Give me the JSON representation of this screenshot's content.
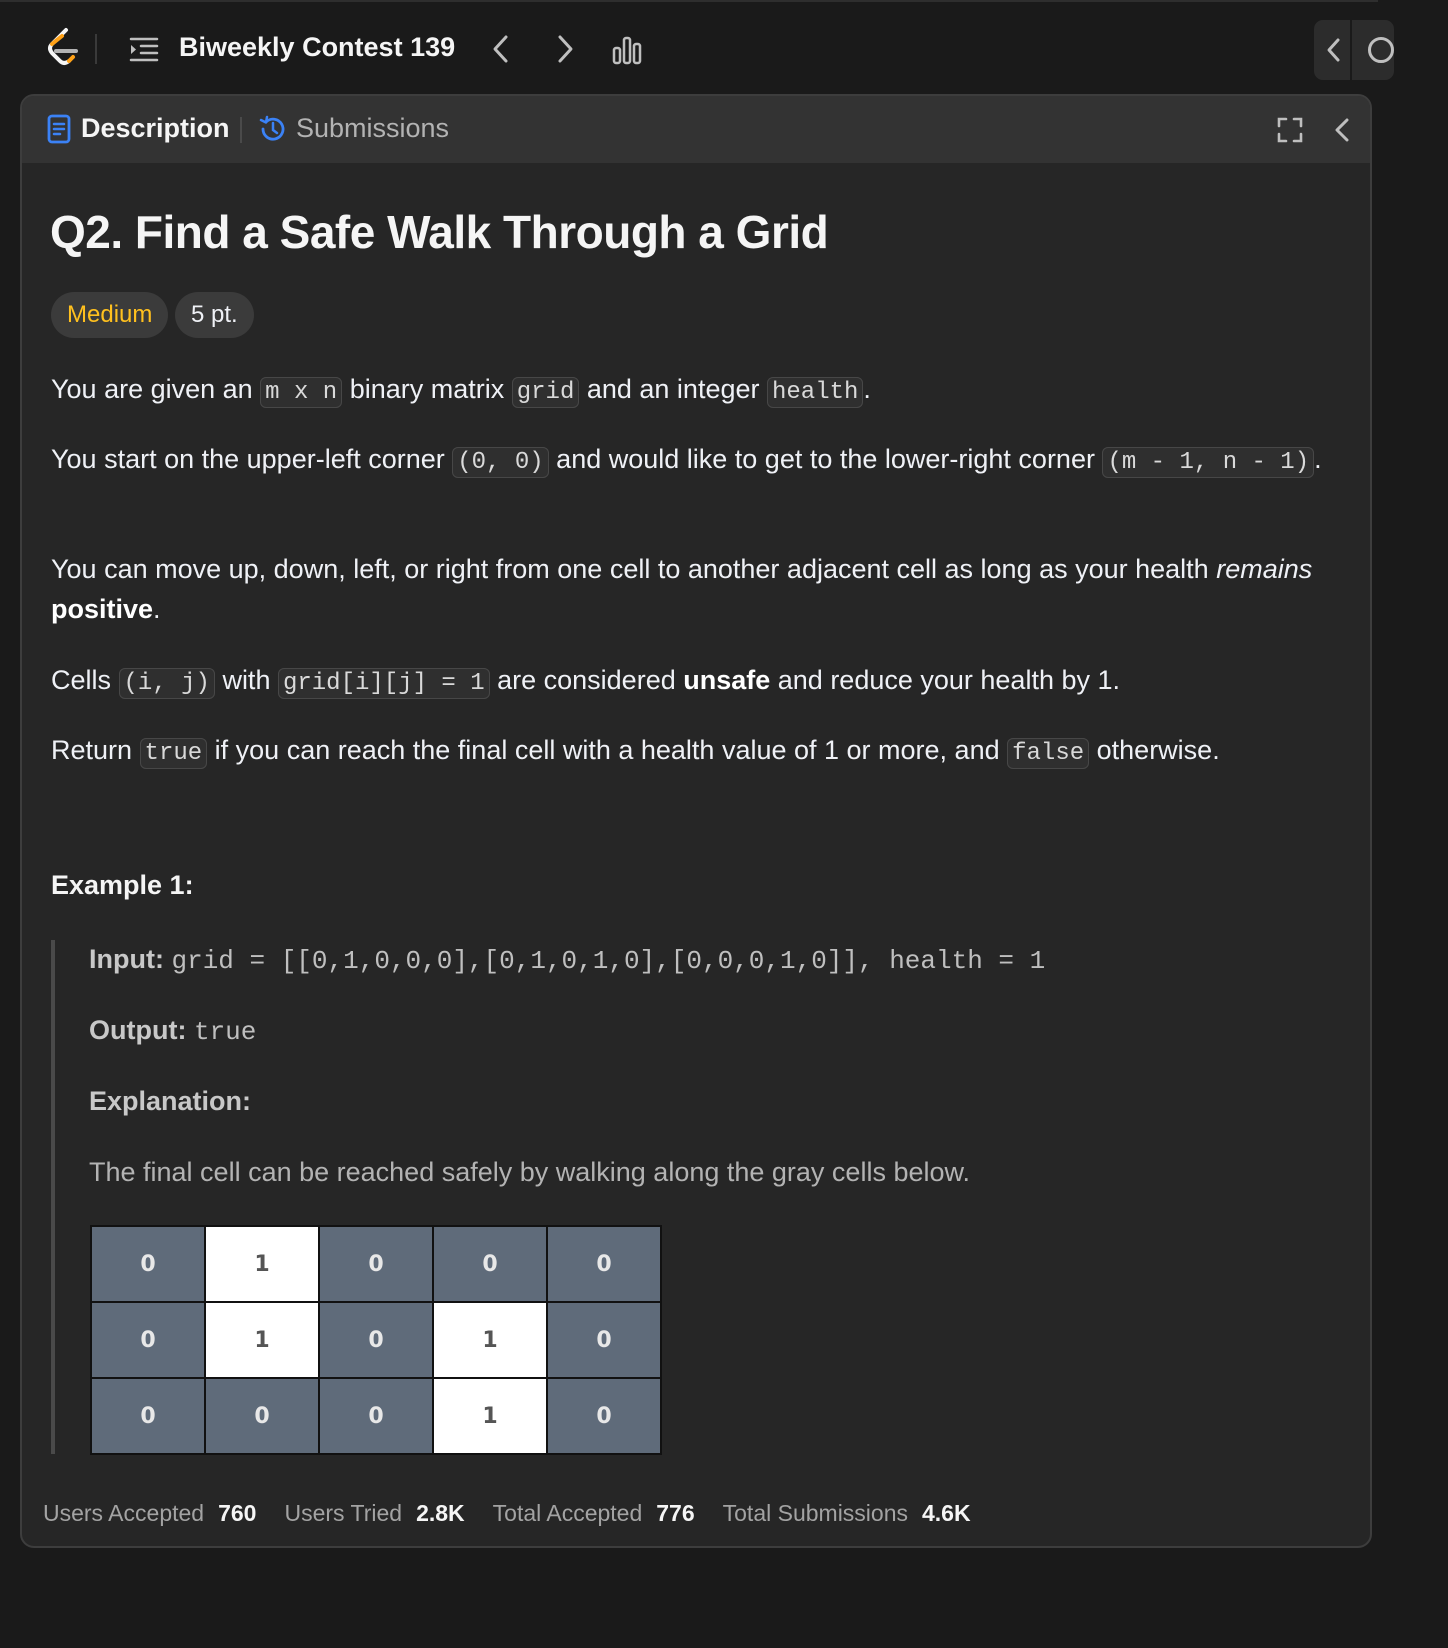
{
  "topbar": {
    "contest_title": "Biweekly Contest 139",
    "icons": [
      "leetcode-logo",
      "list-icon",
      "chevron-left-icon",
      "chevron-right-icon",
      "stats-icon"
    ]
  },
  "tabs": {
    "description": "Description",
    "submissions": "Submissions"
  },
  "problem": {
    "title": "Q2. Find a Safe Walk Through a Grid",
    "difficulty": "Medium",
    "points": "5 pt.",
    "p1": {
      "t1": "You are given an ",
      "c1": "m x n",
      "t2": " binary matrix ",
      "c2": "grid",
      "t3": " and an integer ",
      "c3": "health",
      "t4": "."
    },
    "p2": {
      "t1": "You start on the upper-left corner ",
      "c1": "(0, 0)",
      "t2": " and would like to get to the lower-right corner ",
      "c2": "(m - 1, n - 1)",
      "t3": "."
    },
    "p3": {
      "t1": "You can move up, down, left, or right from one cell to another adjacent cell as long as your health ",
      "i1": "remains",
      "b1": "positive",
      "t2": "."
    },
    "p4": {
      "t1": "Cells ",
      "c1": "(i, j)",
      "t2": " with ",
      "c2": "grid[i][j] = 1",
      "t3": " are considered ",
      "b1": "unsafe",
      "t4": " and reduce your health by 1."
    },
    "p5": {
      "t1": "Return ",
      "c1": "true",
      "t2": " if you can reach the final cell with a health value of 1 or more, and ",
      "c2": "false",
      "t3": " otherwise."
    }
  },
  "example1": {
    "title": "Example 1:",
    "input_label": "Input:",
    "input_value": "grid = [[0,1,0,0,0],[0,1,0,1,0],[0,0,0,1,0]], health = 1",
    "output_label": "Output:",
    "output_value": "true",
    "explanation_label": "Explanation:",
    "explanation_text": "The final cell can be reached safely by walking along the gray cells below.",
    "grid": [
      [
        "0",
        "1",
        "0",
        "0",
        "0"
      ],
      [
        "0",
        "1",
        "0",
        "1",
        "0"
      ],
      [
        "0",
        "0",
        "0",
        "1",
        "0"
      ]
    ]
  },
  "stats": {
    "users_accepted_label": "Users Accepted",
    "users_accepted": "760",
    "users_tried_label": "Users Tried",
    "users_tried": "2.8K",
    "total_accepted_label": "Total Accepted",
    "total_accepted": "776",
    "total_submissions_label": "Total Submissions",
    "total_submissions": "4.6K"
  },
  "colors": {
    "background": "#1a1a1a",
    "panel": "#262626",
    "medium": "#ffc01e",
    "safe_cell": "#5f6b7a",
    "unsafe_cell": "#ffffff"
  }
}
